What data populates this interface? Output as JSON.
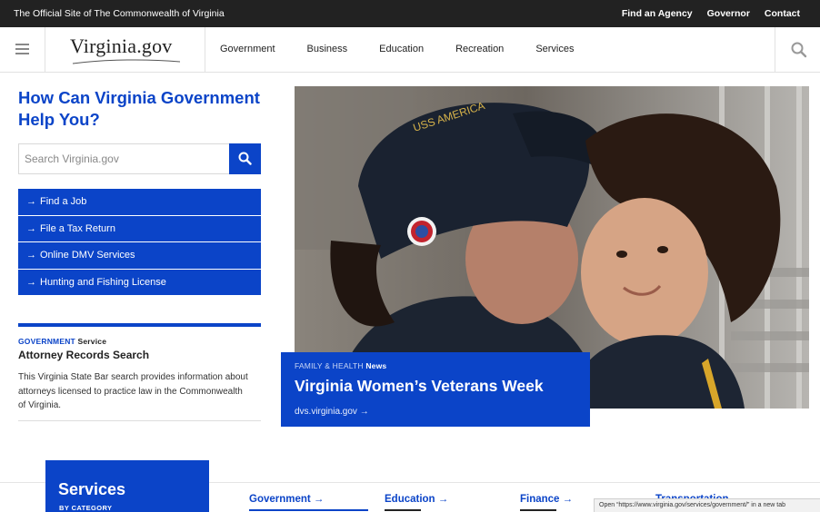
{
  "topbar": {
    "official_text": "The Official Site of The Commonwealth of Virginia",
    "links": [
      "Find an Agency",
      "Governor",
      "Contact"
    ]
  },
  "header": {
    "logo_text": "Virginia.gov",
    "nav": [
      "Government",
      "Business",
      "Education",
      "Recreation",
      "Services"
    ]
  },
  "help": {
    "title": "How Can Virginia Government Help You?",
    "search_placeholder": "Search Virginia.gov",
    "quick_links": [
      "Find a Job",
      "File a Tax Return",
      "Online DMV Services",
      "Hunting and Fishing License"
    ]
  },
  "service_card": {
    "category": "Government",
    "kind": "Service",
    "title": "Attorney Records Search",
    "description": "This Virginia State Bar search provides information about attorneys licensed to practice law in the Commonwealth of Virginia."
  },
  "hero": {
    "category": "Family & Health",
    "kind": "News",
    "headline": "Virginia Women’s Veterans Week",
    "link": "dvs.virginia.gov →"
  },
  "bottom": {
    "services_title": "Services",
    "services_sub": "BY CATEGORY",
    "categories": [
      "Government →",
      "Education →",
      "Finance →"
    ],
    "partial_category": "Transportation"
  },
  "status_bar": "Open “https://www.virginia.gov/services/government/” in a new tab",
  "colors": {
    "brand_blue": "#0b44c8",
    "topbar_bg": "#222222"
  }
}
